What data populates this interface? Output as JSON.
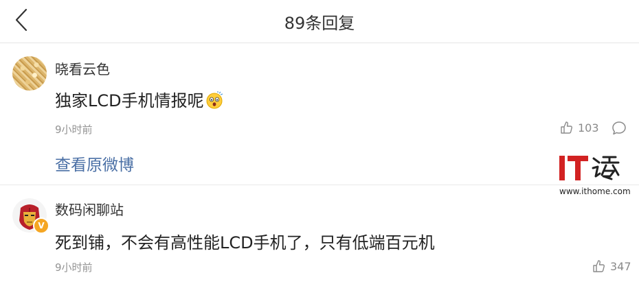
{
  "header": {
    "back_icon": "chevron-left-icon",
    "title": "89条回复"
  },
  "comments": [
    {
      "username": "晓看云色",
      "text": "独家LCD手机情报呢",
      "emoji": "surprised-emoji",
      "time": "9小时前",
      "likes": "103",
      "view_original": "查看原微博",
      "verified": false
    },
    {
      "username": "数码闲聊站",
      "text": "死到铺，不会有高性能LCD手机了，只有低端百元机",
      "time": "9小时前",
      "likes": "347",
      "verified": true,
      "badge": "V"
    }
  ],
  "watermark": {
    "brand": "IT之家",
    "url": "www.ithome.com",
    "accent_color": "#d22222"
  },
  "colors": {
    "link": "#4a6fa5",
    "meta": "#939393",
    "badge": "#f5a623"
  }
}
